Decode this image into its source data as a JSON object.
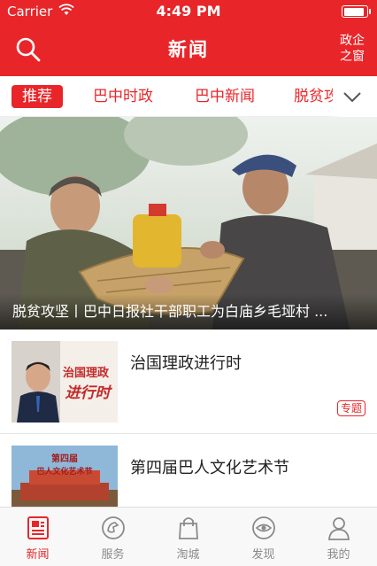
{
  "status_bar": {
    "carrier": "Carrier",
    "time": "4:49 PM"
  },
  "nav": {
    "title": "新闻",
    "right_label": "政企之窗"
  },
  "tabs": [
    {
      "label": "推荐",
      "active": true
    },
    {
      "label": "巴中时政",
      "active": false
    },
    {
      "label": "巴中新闻",
      "active": false
    },
    {
      "label": "脱贫攻坚",
      "active": false
    }
  ],
  "banner": {
    "caption": "脱贫攻坚丨巴中日报社干部职工为白庙乡毛垭村 ..."
  },
  "list": [
    {
      "title": "治国理政进行时",
      "badge": "专题",
      "thumb_text": [
        "治国理政",
        "进行时"
      ]
    },
    {
      "title": "第四届巴人文化艺术节",
      "thumb_text": [
        "第四届",
        "巴人文化艺术节"
      ]
    }
  ],
  "tabbar": [
    {
      "label": "新闻",
      "icon": "news-icon",
      "active": true
    },
    {
      "label": "服务",
      "icon": "service-icon",
      "active": false
    },
    {
      "label": "淘城",
      "icon": "shopping-bag-icon",
      "active": false
    },
    {
      "label": "发现",
      "icon": "discover-icon",
      "active": false
    },
    {
      "label": "我的",
      "icon": "profile-icon",
      "active": false
    }
  ],
  "colors": {
    "accent": "#e8262a",
    "inactive": "#8a8a8a"
  }
}
